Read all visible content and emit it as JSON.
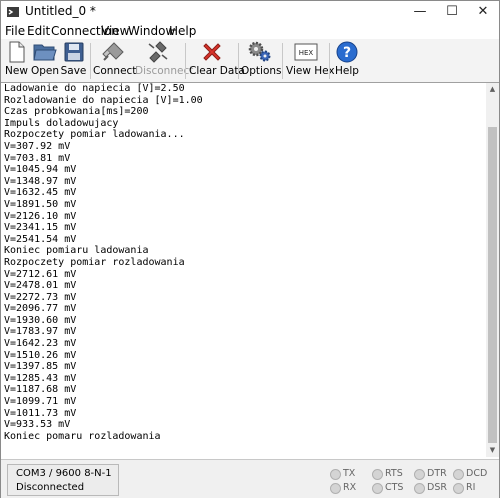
{
  "window": {
    "title": "Untitled_0 *",
    "min_glyph": "—",
    "max_glyph": "☐",
    "close_glyph": "✕"
  },
  "menu": [
    {
      "label": "File"
    },
    {
      "label": "Edit"
    },
    {
      "label": "Connection"
    },
    {
      "label": "View"
    },
    {
      "label": "Window"
    },
    {
      "label": "Help"
    }
  ],
  "toolbar": {
    "new": "New",
    "open": "Open",
    "save": "Save",
    "connect": "Connect",
    "disconnect": "Disconnect",
    "clear_data": "Clear Data",
    "options": "Options",
    "view_hex": "View Hex",
    "hex_icon_text": "HEX",
    "help": "Help"
  },
  "terminal": {
    "lines": [
      "Ladowanie do napiecia [V]=2.50",
      "Rozladowanie do napiecia [V]=1.00",
      "Czas probkowania[ms]=200",
      "Impuls doladowujacy",
      "Rozpoczety pomiar ladowania...",
      "V=307.92 mV",
      "V=703.81 mV",
      "V=1045.94 mV",
      "V=1348.97 mV",
      "V=1632.45 mV",
      "V=1891.50 mV",
      "V=2126.10 mV",
      "V=2341.15 mV",
      "V=2541.54 mV",
      "Koniec pomiaru ladowania",
      "Rozpoczety pomiar rozladowania",
      "V=2712.61 mV",
      "V=2478.01 mV",
      "V=2272.73 mV",
      "V=2096.77 mV",
      "V=1930.60 mV",
      "V=1783.97 mV",
      "V=1642.23 mV",
      "V=1510.26 mV",
      "V=1397.85 mV",
      "V=1285.43 mV",
      "V=1187.68 mV",
      "V=1099.71 mV",
      "V=1011.73 mV",
      "V=933.53 mV",
      "Koniec pomaru rozladowania"
    ]
  },
  "status": {
    "port": "COM3 / 9600 8-N-1",
    "state": "Disconnected",
    "indicators": {
      "tx": "TX",
      "rx": "RX",
      "rts": "RTS",
      "cts": "CTS",
      "dtr": "DTR",
      "dsr": "DSR",
      "dcd": "DCD",
      "ri": "RI"
    }
  },
  "colors": {
    "help_blue": "#2a6ccf",
    "close_red": "#d9342b",
    "led_off": "#d4d4d4"
  },
  "icons": [
    "app-icon",
    "new-file-icon",
    "open-folder-icon",
    "save-disk-icon",
    "connect-plug-icon",
    "disconnect-plug-icon",
    "clear-data-icon",
    "options-gears-icon",
    "view-hex-icon",
    "help-icon"
  ]
}
